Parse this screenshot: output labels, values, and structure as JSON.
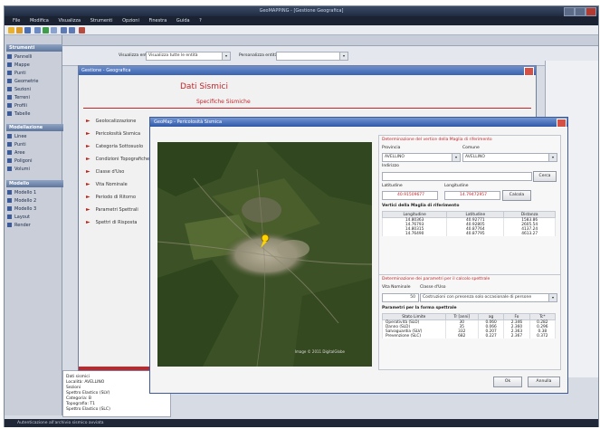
{
  "app": {
    "title": "GeoMAPPING - [Gestione Geografica]",
    "menu": [
      "File",
      "Modifica",
      "Visualizza",
      "Strumenti",
      "Opzioni",
      "Finestra",
      "Guida",
      "?"
    ],
    "statusbar": "Autenticazione all'archivio sismico avviata"
  },
  "leftnav": {
    "head1": "Strumenti",
    "items1": [
      "Pannelli",
      "Mappe",
      "Punti",
      "Geometrie",
      "Sezioni",
      "Terreni",
      "Profili",
      "Tabelle"
    ],
    "head2": "Modellazione",
    "items2": [
      "Linee",
      "Punti",
      "Aree",
      "Poligoni",
      "Volumi"
    ],
    "head3": "Modello",
    "items3": [
      "Modello 1",
      "Modello 2",
      "Modello 3",
      "Layout",
      "Render"
    ]
  },
  "ribbon": {
    "label1": "Visualizza entità",
    "select1": "Visualizza tutte le entità",
    "label2": "Personalizza entità"
  },
  "geo_window": {
    "title": "Gestione - Geografica",
    "header": "Dati Sismici",
    "subheader": "Specifiche Sismiche",
    "items": [
      "Geolocalizzazione",
      "Pericolosità Sismica",
      "Categoria Sottosuolo",
      "Condizioni Topografiche",
      "Classe d'Uso",
      "Vita Nominale",
      "Periodo di Ritorno",
      "Parametri Spettrali",
      "Spettri di Risposta"
    ]
  },
  "dialog": {
    "title": "GeoMap - Pericolosità Sismica",
    "section1": {
      "title": "Determinazione del vertice della Maglia di riferimento",
      "provincia_label": "Provincia",
      "provincia_value": "AVELLINO",
      "comune_label": "Comune",
      "comune_value": "AVELLINO",
      "indirizzo_label": "Indirizzo",
      "indirizzo_value": "",
      "cerca_label": "Cerca",
      "latitudine_label": "Latitudine",
      "longitudine_label": "Longitudine",
      "latitudine_value": "40.91509677",
      "longitudine_value": "14.79472957",
      "calcola_label": "Calcola",
      "grid_title": "Vertici della Maglia di riferimento",
      "grid_headers": [
        "Longitudine",
        "Latitudine",
        "Distanza"
      ],
      "grid_rows": [
        [
          "14.80363",
          "40.92771",
          "1583.86"
        ],
        [
          "14.76793",
          "40.92805",
          "2605.54"
        ],
        [
          "14.80315",
          "40.87764",
          "4137.24"
        ],
        [
          "14.76490",
          "40.87795",
          "4613.27"
        ]
      ]
    },
    "section2": {
      "title": "Determinazione dei parametri per il calcolo spettrale",
      "vita_label": "Vita Nominale",
      "vita_value": "50",
      "classe_label": "Classe d'Uso",
      "classe_value": "Costruzioni con presenza solo occasionale di persone",
      "grid_title": "Parametri per la forma spettrale",
      "grid_headers": [
        "Stato Limite",
        "Tr [anni]",
        "ag",
        "Fo",
        "Tc*"
      ],
      "grid_rows": [
        [
          "Operatività (SLO)",
          "30",
          "0.060",
          "2.346",
          "0.282"
        ],
        [
          "Danno (SLD)",
          "35",
          "0.066",
          "2.360",
          "0.296"
        ],
        [
          "Salvaguardia (SLV)",
          "332",
          "0.207",
          "2.363",
          "0.38"
        ],
        [
          "Prevenzione (SLC)",
          "682",
          "0.227",
          "2.367",
          "0.372"
        ]
      ]
    },
    "ok_label": "Ok",
    "cancel_label": "Annulla",
    "map_caption": "Image © 2011 DigitalGlobe"
  },
  "bottom_info": {
    "lines": [
      "Dati sismici",
      "Località: AVELLINO",
      "Sezioni",
      "Spettro Elastico (SLV)",
      "Categoria: B",
      "Topografia: T1",
      "Spettro Elastico (SLC)"
    ]
  },
  "colors": {
    "accent_red": "#c0262a",
    "title_blue": "#2f58a8",
    "nav_bg": "#c9ced8"
  }
}
